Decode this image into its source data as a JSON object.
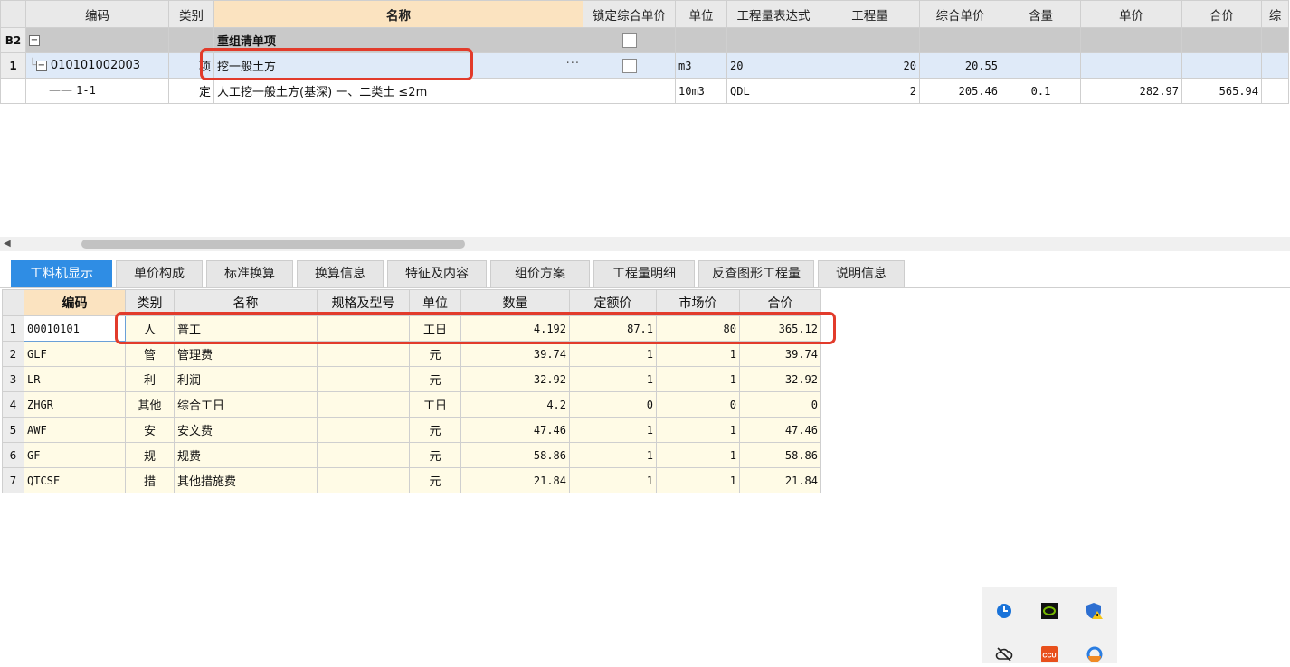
{
  "upper": {
    "headers": [
      "",
      "编码",
      "类别",
      "名称",
      "锁定综合单价",
      "单位",
      "工程量表达式",
      "工程量",
      "综合单价",
      "含量",
      "单价",
      "合价",
      "综"
    ],
    "group_row": {
      "num": "B2",
      "name": "重组清单项"
    },
    "row1": {
      "num": "1",
      "code": "010101002003",
      "type": "项",
      "name": "挖一般土方",
      "unit": "m3",
      "expr": "20",
      "qty": "20",
      "comp_price": "20.55"
    },
    "row2": {
      "code": "1-1",
      "type": "定",
      "name": "人工挖一般土方(基深) 一、二类土 ≤2m",
      "unit": "10m3",
      "expr": "QDL",
      "qty": "2",
      "comp_price": "205.46",
      "content": "0.1",
      "price": "282.97",
      "total": "565.94"
    }
  },
  "tabs": [
    "工料机显示",
    "单价构成",
    "标准换算",
    "换算信息",
    "特征及内容",
    "组价方案",
    "工程量明细",
    "反查图形工程量",
    "说明信息"
  ],
  "lower": {
    "headers": [
      "",
      "编码",
      "类别",
      "名称",
      "规格及型号",
      "单位",
      "数量",
      "定额价",
      "市场价",
      "合价"
    ],
    "rows": [
      {
        "num": "1",
        "code": "00010101",
        "type": "人",
        "name": "普工",
        "spec": "",
        "unit": "工日",
        "qty": "4.192",
        "quota": "87.1",
        "market": "80",
        "total": "365.12"
      },
      {
        "num": "2",
        "code": "GLF",
        "type": "管",
        "name": "管理费",
        "spec": "",
        "unit": "元",
        "qty": "39.74",
        "quota": "1",
        "market": "1",
        "total": "39.74"
      },
      {
        "num": "3",
        "code": "LR",
        "type": "利",
        "name": "利润",
        "spec": "",
        "unit": "元",
        "qty": "32.92",
        "quota": "1",
        "market": "1",
        "total": "32.92"
      },
      {
        "num": "4",
        "code": "ZHGR",
        "type": "其他",
        "name": "综合工日",
        "spec": "",
        "unit": "工日",
        "qty": "4.2",
        "quota": "0",
        "market": "0",
        "total": "0"
      },
      {
        "num": "5",
        "code": "AWF",
        "type": "安",
        "name": "安文费",
        "spec": "",
        "unit": "元",
        "qty": "47.46",
        "quota": "1",
        "market": "1",
        "total": "47.46"
      },
      {
        "num": "6",
        "code": "GF",
        "type": "规",
        "name": "规费",
        "spec": "",
        "unit": "元",
        "qty": "58.86",
        "quota": "1",
        "market": "1",
        "total": "58.86"
      },
      {
        "num": "7",
        "code": "QTCSF",
        "type": "措",
        "name": "其他措施费",
        "spec": "",
        "unit": "元",
        "qty": "21.84",
        "quota": "1",
        "market": "1",
        "total": "21.84"
      }
    ]
  },
  "tray": {
    "icons": [
      "clock-icon",
      "nvidia-icon",
      "shield-warning-icon",
      "cloud-off-icon",
      "ccu-icon",
      "sync-icon"
    ],
    "ccu_label": "CCU"
  },
  "colors": {
    "active_tab": "#2f8de4",
    "highlight": "#e23b2b",
    "selected_row": "#dfeaf8",
    "lower_row": "#fffbe6"
  }
}
